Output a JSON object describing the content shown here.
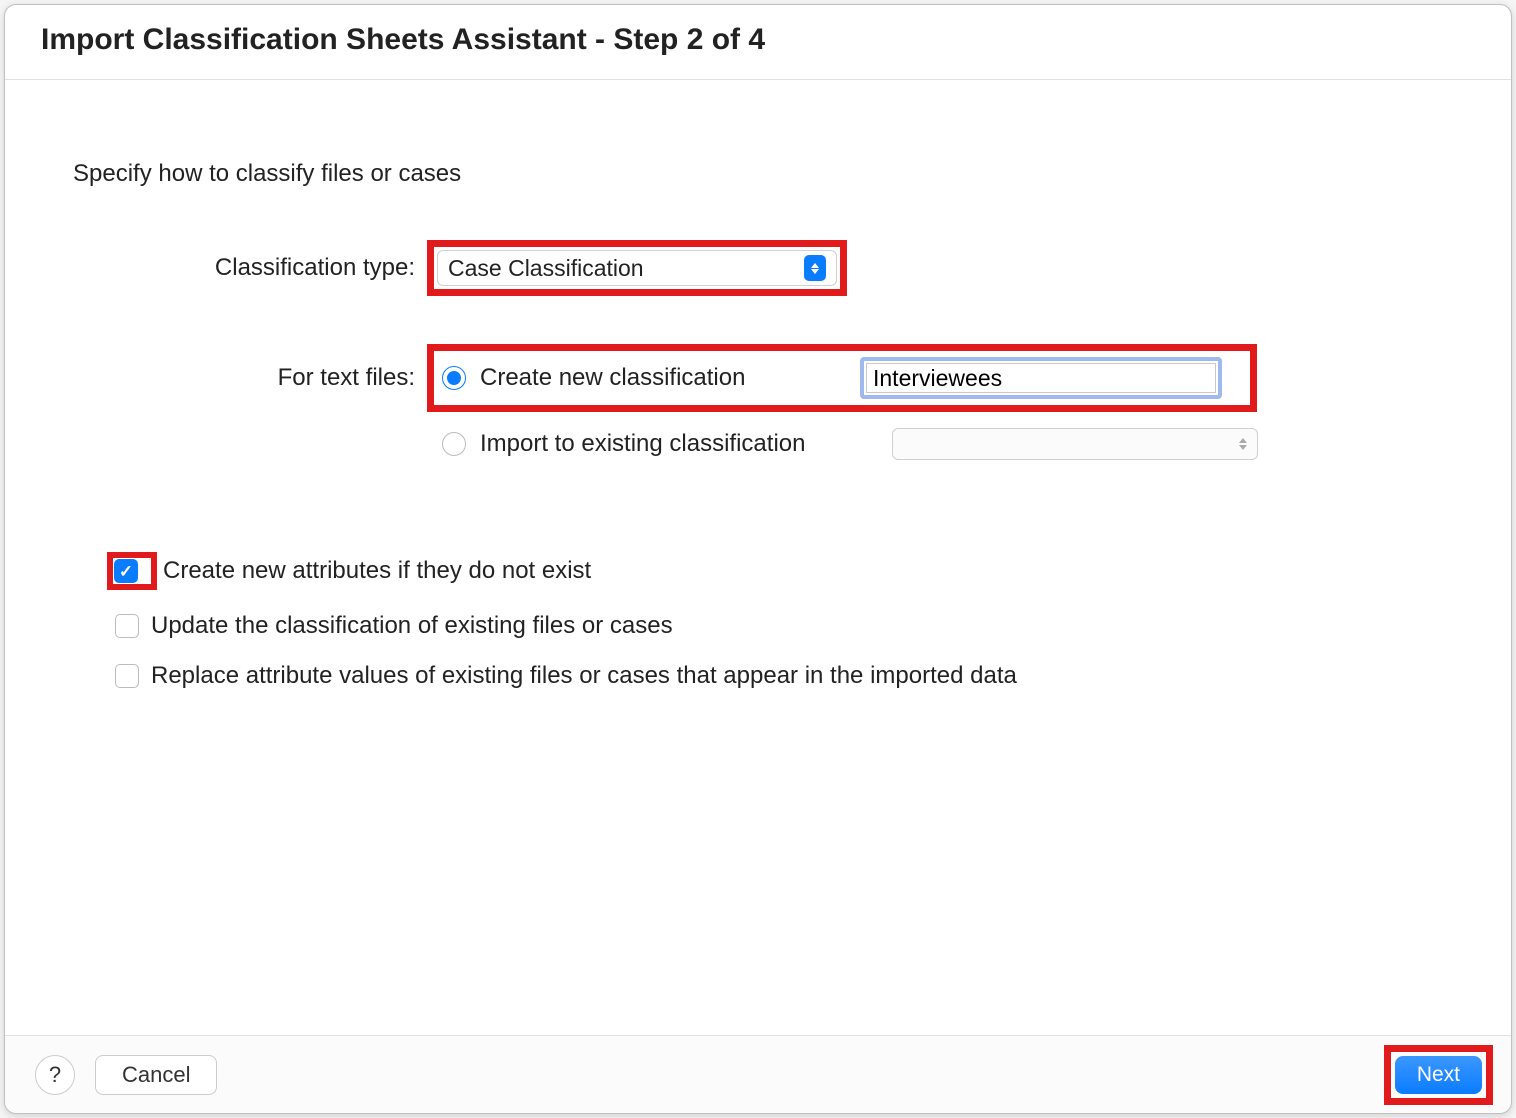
{
  "dialog": {
    "title": "Import Classification Sheets Assistant - Step 2 of 4",
    "instruction": "Specify how to classify files or cases",
    "classification_type_label": "Classification type:",
    "classification_type_value": "Case Classification",
    "for_text_files_label": "For text files:",
    "radio_create_label": "Create new classification",
    "radio_create_input_value": "Interviewees",
    "radio_import_label": "Import to existing classification",
    "radio_import_select_value": "",
    "checkbox_create_attributes": "Create new attributes if they do not exist",
    "checkbox_update_classification": "Update the classification of existing files or cases",
    "checkbox_replace_values": "Replace attribute values of existing files or cases that appear in the imported data"
  },
  "footer": {
    "help": "?",
    "cancel": "Cancel",
    "next": "Next"
  },
  "state": {
    "classification_type_selected": "Case Classification",
    "radio_selected": "create",
    "checkbox_create_attributes_checked": true,
    "checkbox_update_classification_checked": false,
    "checkbox_replace_values_checked": false
  },
  "colors": {
    "highlight": "#e11b1b",
    "primary": "#0a7cff",
    "focus_ring": "#9fb9ef"
  }
}
